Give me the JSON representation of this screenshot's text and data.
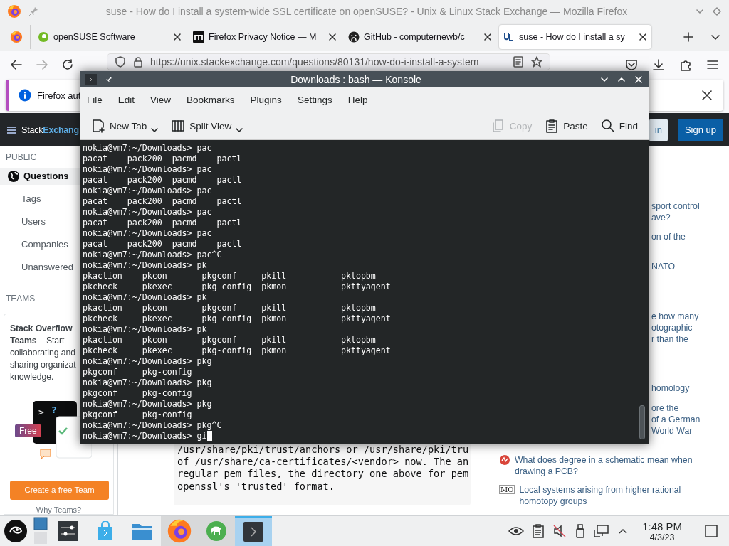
{
  "firefox": {
    "title": "suse - How do I install a system-wide SSL certificate on openSUSE? - Unix & Linux Stack Exchange — Mozilla Firefox",
    "tabs": [
      {
        "label": "openSUSE Software",
        "selected": false
      },
      {
        "label": "Firefox Privacy Notice — M",
        "selected": false
      },
      {
        "label": "GitHub - computernewb/c",
        "selected": false
      },
      {
        "label": "suse - How do I install a sy",
        "selected": true
      }
    ],
    "forward_disabled": true,
    "url": "https://unix.stackexchange.com/questions/80131/how-do-i-install-a-system",
    "notification": "Firefox aut"
  },
  "site_header": {
    "logo_left": "Stack",
    "logo_right": "Exchang",
    "login": "in",
    "signup": "Sign up"
  },
  "sidebar": {
    "public_heading": "PUBLIC",
    "items": [
      {
        "label": "Questions",
        "selected": true
      },
      {
        "label": "Tags",
        "selected": false
      },
      {
        "label": "Users",
        "selected": false
      },
      {
        "label": "Companies",
        "selected": false
      },
      {
        "label": "Unanswered",
        "selected": false
      }
    ],
    "teams_heading": "TEAMS",
    "teams_promo": [
      "**Stack Overflow**",
      "**Teams** – Start",
      "collaborating and",
      "sharing organizat",
      "knowledge."
    ],
    "art_prompt": ">_",
    "art_mark": "?",
    "art_badge": "Free",
    "create_button": "Create a free Team",
    "why_link": "Why Teams?"
  },
  "question": {
    "code_lines": [
      "/usr/share/pki/trust/anchors or /usr/share/pki/tru",
      "of /usr/share/ca-certificates/<vendor> now. The an",
      "regular pem files, the directory one above for pem",
      "openssl's 'trusted' format."
    ]
  },
  "hot_questions": {
    "fragments": [
      [
        "sport control",
        "ave?"
      ],
      [
        "on of the"
      ],
      [
        "NATO"
      ],
      [
        "e how many",
        "otographic",
        "r than the"
      ],
      [
        "homology"
      ],
      [
        "ore the",
        "of a German",
        "World War"
      ]
    ],
    "items": [
      {
        "title": "What does degree in a schematic mean when drawing a PCB?",
        "kind": "circuit"
      },
      {
        "title": "Local systems arising from higher rational homotopy groups",
        "kind": "badge",
        "badge": "MO"
      }
    ]
  },
  "konsole": {
    "title": "Downloads : bash — Konsole",
    "menu": [
      "File",
      "Edit",
      "View",
      "Bookmarks",
      "Plugins",
      "Settings",
      "Help"
    ],
    "toolbar": [
      {
        "label": "New Tab",
        "disabled": false
      },
      {
        "label": "Split View",
        "disabled": false
      },
      {
        "label": "Copy",
        "disabled": true
      },
      {
        "label": "Paste",
        "disabled": false
      },
      {
        "label": "Find",
        "disabled": false
      }
    ],
    "lines": [
      "nokia@vm7:~/Downloads> pac",
      "pacat    pack200  pacmd    pactl",
      "nokia@vm7:~/Downloads> pac",
      "pacat    pack200  pacmd    pactl",
      "nokia@vm7:~/Downloads> pac",
      "pacat    pack200  pacmd    pactl",
      "nokia@vm7:~/Downloads> pac",
      "pacat    pack200  pacmd    pactl",
      "nokia@vm7:~/Downloads> pac",
      "pacat    pack200  pacmd    pactl",
      "nokia@vm7:~/Downloads> pac^C",
      "nokia@vm7:~/Downloads> pk",
      "pkaction    pkcon       pkgconf     pkill           pktopbm",
      "pkcheck     pkexec      pkg-config  pkmon           pkttyagent",
      "nokia@vm7:~/Downloads> pk",
      "pkaction    pkcon       pkgconf     pkill           pktopbm",
      "pkcheck     pkexec      pkg-config  pkmon           pkttyagent",
      "nokia@vm7:~/Downloads> pk",
      "pkaction    pkcon       pkgconf     pkill           pktopbm",
      "pkcheck     pkexec      pkg-config  pkmon           pkttyagent",
      "nokia@vm7:~/Downloads> pkg",
      "pkgconf     pkg-config",
      "nokia@vm7:~/Downloads> pkg",
      "pkgconf     pkg-config",
      "nokia@vm7:~/Downloads> pkg",
      "pkgconf     pkg-config",
      "nokia@vm7:~/Downloads> pkg^C",
      "nokia@vm7:~/Downloads> gi"
    ]
  },
  "taskbar": {
    "tasks": [
      {
        "running": true,
        "selected": false
      },
      {
        "running": true,
        "selected": false
      },
      {
        "running": true,
        "selected": true
      }
    ],
    "time": "1:48 PM",
    "date": "4/3/23"
  }
}
